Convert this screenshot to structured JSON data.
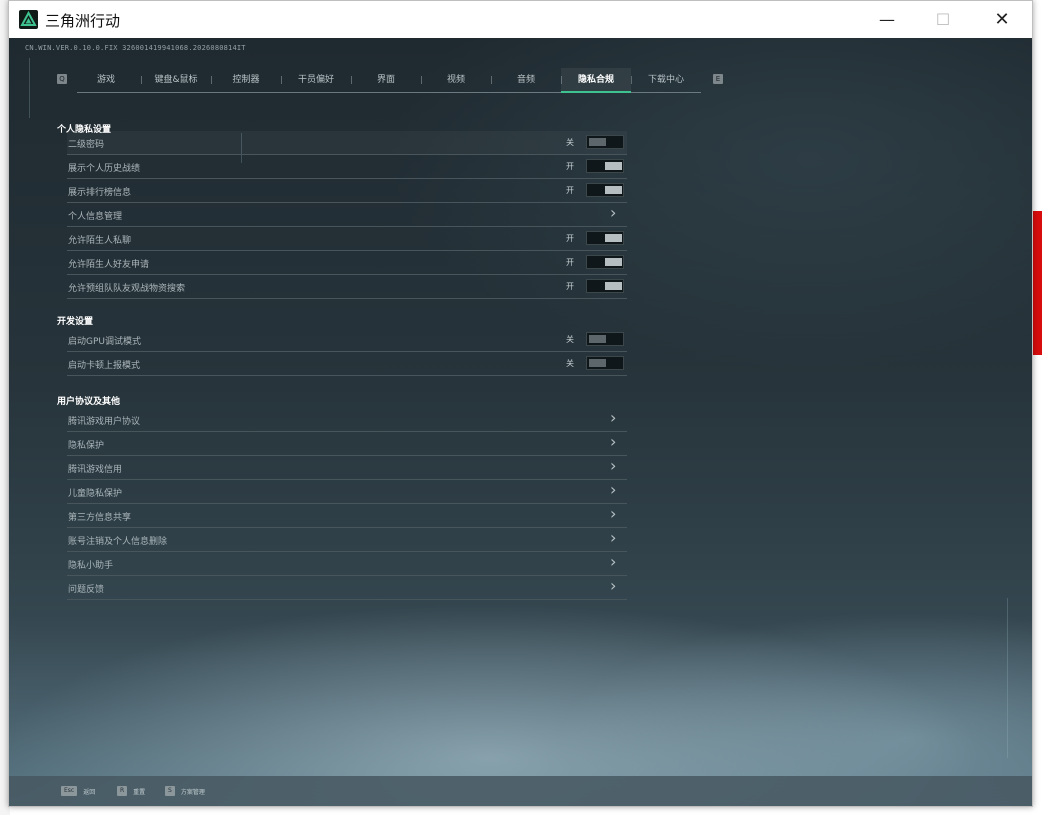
{
  "window": {
    "title": "三角洲行动",
    "minimize_glyph": "—",
    "maximize_glyph": "☐",
    "close_glyph": "✕"
  },
  "build_id": "CN.WIN.VER.0.10.0.FIX 326001419941068.2026080814IT",
  "tabs": {
    "prev_key": "Q",
    "next_key": "E",
    "items": [
      {
        "label": "游戏"
      },
      {
        "label": "键盘&鼠标"
      },
      {
        "label": "控制器"
      },
      {
        "label": "干员偏好"
      },
      {
        "label": "界面"
      },
      {
        "label": "视频"
      },
      {
        "label": "音频"
      },
      {
        "label": "隐私合规"
      },
      {
        "label": "下载中心"
      }
    ],
    "active_index": 7
  },
  "sections": {
    "privacy": {
      "title": "个人隐私设置",
      "rows": [
        {
          "label": "二级密码",
          "state": "关",
          "control": "toggle",
          "on": false
        },
        {
          "label": "展示个人历史战绩",
          "state": "开",
          "control": "toggle",
          "on": true
        },
        {
          "label": "展示排行榜信息",
          "state": "开",
          "control": "toggle",
          "on": true
        },
        {
          "label": "个人信息管理",
          "state": "",
          "control": "chevron"
        },
        {
          "label": "允许陌生人私聊",
          "state": "开",
          "control": "toggle",
          "on": true
        },
        {
          "label": "允许陌生人好友申请",
          "state": "开",
          "control": "toggle",
          "on": true
        },
        {
          "label": "允许预组队队友观战物资搜索",
          "state": "开",
          "control": "toggle",
          "on": true
        }
      ]
    },
    "developer": {
      "title": "开发设置",
      "rows": [
        {
          "label": "启动GPU调试模式",
          "state": "关",
          "control": "toggle",
          "on": false
        },
        {
          "label": "启动卡顿上报模式",
          "state": "关",
          "control": "toggle",
          "on": false
        }
      ]
    },
    "agreements": {
      "title": "用户协议及其他",
      "rows": [
        {
          "label": "腾讯游戏用户协议",
          "control": "chevron"
        },
        {
          "label": "隐私保护",
          "control": "chevron"
        },
        {
          "label": "腾讯游戏信用",
          "control": "chevron"
        },
        {
          "label": "儿童隐私保护",
          "control": "chevron"
        },
        {
          "label": "第三方信息共享",
          "control": "chevron"
        },
        {
          "label": "账号注销及个人信息删除",
          "control": "chevron"
        },
        {
          "label": "隐私小助手",
          "control": "chevron"
        },
        {
          "label": "问题反馈",
          "control": "chevron"
        }
      ]
    }
  },
  "bottom_bar": {
    "hints": [
      {
        "key": "Esc",
        "text": "返回"
      },
      {
        "key": "R",
        "text": "重置"
      },
      {
        "key": "S",
        "text": "方案管理"
      }
    ]
  },
  "colors": {
    "accent": "#3ec28f",
    "background_top": "#1f2a30",
    "background_bottom": "#5b7886",
    "text": "#aab6ba"
  },
  "icons": {
    "app": "delta-force-logo-icon",
    "chevron": "chevron-right-icon"
  }
}
